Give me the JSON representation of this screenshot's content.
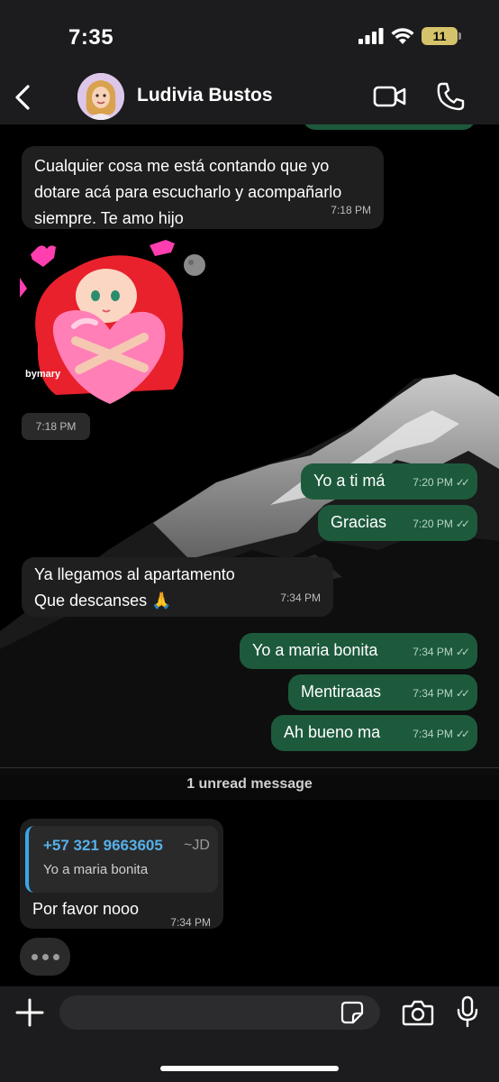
{
  "status": {
    "time": "7:35",
    "battery": "11"
  },
  "header": {
    "contact_name": "Ludivia Bustos"
  },
  "messages": [
    {
      "direction": "in",
      "text": "Cualquier cosa me está contando que yo dotare acá para escucharlo y acompañarlo siempre. Te amo hijo",
      "time": "7:18 PM"
    },
    {
      "direction": "in",
      "type": "sticker",
      "sticker_caption": "bymary",
      "time": "7:18 PM"
    },
    {
      "direction": "out",
      "text": "Yo a ti má",
      "time": "7:20 PM",
      "status": "read"
    },
    {
      "direction": "out",
      "text": "Gracias",
      "time": "7:20 PM",
      "status": "read"
    },
    {
      "direction": "in",
      "text_line1": "Ya llegamos al apartamento",
      "text_line2": "Que descanses 🙏",
      "time": "7:34 PM"
    },
    {
      "direction": "out",
      "text": "Yo a maria bonita",
      "time": "7:34 PM",
      "status": "read"
    },
    {
      "direction": "out",
      "text": "Mentiraaas",
      "time": "7:34 PM",
      "status": "read"
    },
    {
      "direction": "out",
      "text": "Ah bueno ma",
      "time": "7:34 PM",
      "status": "read"
    },
    {
      "direction": "in",
      "quoted": {
        "phone": "+57 321 9663605",
        "alias": "~JD",
        "text": "Yo a maria bonita"
      },
      "text": "Por favor nooo",
      "time": "7:34 PM"
    }
  ],
  "unread_divider": "1 unread message",
  "input": {
    "placeholder": "",
    "value": ""
  },
  "colors": {
    "incoming_bubble": "#1f1f1f",
    "outgoing_bubble": "#1d5a3c",
    "quote_accent": "#3aa7e8",
    "bars": "#1c1c1e"
  },
  "icons": [
    "back-chevron-icon",
    "video-call-icon",
    "phone-icon",
    "plus-icon",
    "sticker-icon",
    "camera-icon",
    "microphone-icon",
    "signal-icon",
    "wifi-icon",
    "battery-icon",
    "read-ticks-icon"
  ]
}
